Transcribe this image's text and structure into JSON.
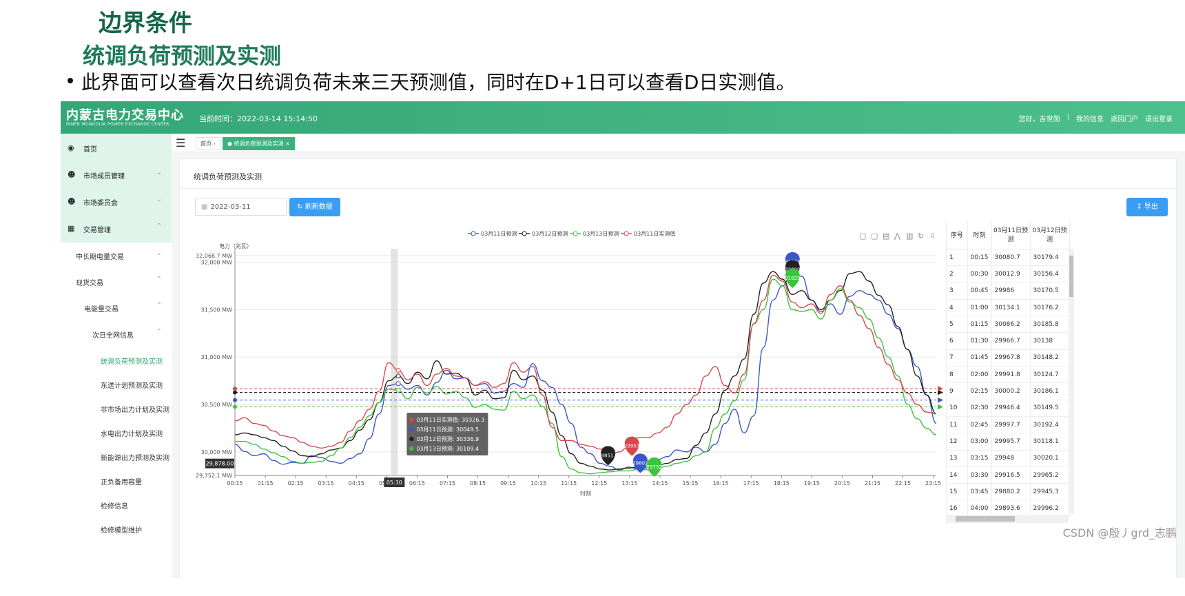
{
  "slide": {
    "title": "边界条件",
    "subtitle": "统调负荷预测及实测",
    "bullet": "此界面可以查看次日统调负荷未来三天预测值，同时在D+1日可以查看D日实测值。"
  },
  "app": {
    "logo_main": "内蒙古电力交易中心",
    "logo_sub": "INNER MONGOLIA POWER EXCHANGE CENTER",
    "current_time": "当前时间：2022-03-14 15:14:50",
    "greeting": "您好，吉世勋",
    "links": [
      "我的信息",
      "返回门户",
      "退出登录"
    ]
  },
  "sidebar": {
    "items": [
      {
        "label": "首页",
        "icon": "dashboard-icon"
      },
      {
        "label": "市场成员管理",
        "icon": "user-icon"
      },
      {
        "label": "市场委员会",
        "icon": "users-icon"
      },
      {
        "label": "交易管理",
        "icon": "grid-icon"
      }
    ],
    "sub_items": [
      "中长期电量交易",
      "现货交易",
      "电能量交易",
      "次日全网信息",
      "统调负荷预测及实测",
      "东送计划预测及实测",
      "非市场出力计划及实测",
      "水电出力计划及实测",
      "新能源出力预测及实测",
      "正负备用容量",
      "检修信息",
      "检修模型维护"
    ]
  },
  "tabs": {
    "home": "首页",
    "active": "● 统调负荷预测及实测"
  },
  "panel": {
    "title": "统调负荷预测及实测",
    "date_value": "2022-03-11",
    "refresh_label": "刷新数据",
    "export_label": "导出"
  },
  "chart_data": {
    "type": "line",
    "ylabel": "电力（兆瓦）",
    "xlabel": "时刻",
    "y_ticks": [
      "32,068.7 MW",
      "32,000 MW",
      "31,500 MW",
      "31,000 MW",
      "30,500 MW",
      "30,000 MW",
      "29,752.1 MW"
    ],
    "ylim": [
      29752.1,
      32068.7
    ],
    "x_ticks": [
      "00:15",
      "01:15",
      "02:15",
      "03:15",
      "04:15",
      "05:15",
      "06:15",
      "07:15",
      "08:15",
      "09:15",
      "10:15",
      "11:15",
      "12:15",
      "13:15",
      "14:15",
      "15:15",
      "16:15",
      "17:15",
      "18:15",
      "19:15",
      "20:15",
      "21:15",
      "22:15",
      "23:15"
    ],
    "axis_pointer_x": "05:30",
    "axis_pointer_y": "29,878.00",
    "series": [
      {
        "name": "03月11日预测",
        "color": "#3a57c9",
        "values": [
          30081,
          30005,
          29960,
          29980,
          29910,
          29870,
          29890,
          29880,
          29960,
          29940,
          29900,
          29880,
          29930,
          29980,
          30140,
          30400,
          30700,
          30720,
          30660,
          30700,
          30600,
          30730,
          30860,
          30770,
          30780,
          30700,
          30720,
          30620,
          30640,
          30720,
          30680,
          30930,
          30750,
          30680,
          30500,
          30300,
          30050,
          29980,
          29880,
          29850,
          29810,
          29840,
          29820,
          29900,
          29920,
          29950,
          30020,
          30000,
          30050,
          30000,
          30080,
          30300,
          30450,
          30200,
          30380,
          31100,
          31600,
          31750,
          31900,
          31850,
          31600,
          31480,
          31560,
          31450,
          31640,
          31700,
          31660,
          31600,
          31450,
          31300,
          31080,
          30900,
          30600,
          30300
        ]
      },
      {
        "name": "03月12日预测",
        "color": "#222222",
        "values": [
          30179,
          30200,
          30180,
          30150,
          30120,
          30060,
          30010,
          29960,
          29950,
          29980,
          30020,
          30040,
          30120,
          30230,
          30340,
          30520,
          30750,
          30800,
          30720,
          30840,
          30770,
          30960,
          30820,
          30830,
          30780,
          30600,
          30650,
          30560,
          30570,
          30860,
          30760,
          30800,
          30650,
          30420,
          30170,
          29980,
          29880,
          29850,
          29820,
          29810,
          29820,
          29830,
          29840,
          29830,
          29860,
          29880,
          29920,
          29930,
          30070,
          30200,
          30400,
          30650,
          30800,
          30980,
          31450,
          31780,
          31900,
          31820,
          31660,
          31700,
          31600,
          31500,
          31600,
          31700,
          31880,
          31900,
          31800,
          31650,
          31550,
          31320,
          31080,
          30800,
          30600,
          30400
        ]
      },
      {
        "name": "03月13日预测",
        "color": "#3cc43c",
        "values": [
          30109,
          30110,
          30080,
          30030,
          29990,
          29950,
          29900,
          29880,
          29890,
          29900,
          29960,
          30040,
          30150,
          30260,
          30380,
          30520,
          30660,
          30650,
          30560,
          30680,
          30620,
          30690,
          30610,
          30640,
          30570,
          30470,
          30500,
          30450,
          30440,
          30640,
          30560,
          30600,
          30480,
          30300,
          29950,
          29820,
          29780,
          29770,
          29780,
          29790,
          29800,
          29800,
          29820,
          29810,
          29830,
          29850,
          29880,
          29900,
          29960,
          30000,
          30250,
          30400,
          30540,
          30760,
          31350,
          31500,
          31820,
          31750,
          31500,
          31480,
          31500,
          31400,
          31600,
          31720,
          31580,
          31520,
          31400,
          31200,
          31000,
          30800,
          30500,
          30350,
          30250,
          30180
        ]
      },
      {
        "name": "03月11日实测值",
        "color": "#d9474a",
        "values": [
          30326,
          30360,
          30300,
          30280,
          30220,
          30170,
          30150,
          30100,
          30060,
          30040,
          30060,
          30100,
          30220,
          30330,
          30450,
          30640,
          30940,
          30860,
          30760,
          30820,
          30700,
          30820,
          30880,
          30800,
          30780,
          30700,
          30740,
          30680,
          30720,
          30940,
          30840,
          30900,
          30600,
          30260,
          30120,
          30120,
          30080,
          30060,
          30030,
          29960,
          30000,
          30060,
          30150,
          30150,
          30200,
          30260,
          30400,
          30500,
          30600,
          30800,
          30900,
          30700,
          30620,
          30820,
          31350,
          31600,
          31860,
          31800,
          31580,
          31520,
          31560,
          31460,
          31660,
          31750,
          31600,
          31440,
          31300,
          31100,
          30920,
          30760,
          30620,
          30500,
          30420,
          30400
        ]
      }
    ],
    "tooltip": {
      "lines": [
        "03月11日实测值: 30326.3",
        "03月11日预测: 30049.5",
        "03月12日预测: 30336.9",
        "03月13日预测: 30109.4"
      ]
    },
    "markers": [
      {
        "label": "32003",
        "series": 0
      },
      {
        "label": "32000",
        "series": 1
      },
      {
        "label": "31829",
        "series": 2
      },
      {
        "label": "29851.3",
        "series": 1
      },
      {
        "label": "29957",
        "series": 3
      },
      {
        "label": "29802",
        "series": 0
      },
      {
        "label": "29752",
        "series": 2
      }
    ]
  },
  "table": {
    "headers": [
      "序号",
      "时刻",
      "03月11日预测",
      "03月12日预测"
    ],
    "rows": [
      [
        "1",
        "00:15",
        "30080.7",
        "30179.4"
      ],
      [
        "2",
        "00:30",
        "30012.9",
        "30156.4"
      ],
      [
        "3",
        "00:45",
        "29986",
        "30170.5"
      ],
      [
        "4",
        "01:00",
        "30134.1",
        "30176.2"
      ],
      [
        "5",
        "01:15",
        "30086.2",
        "30185.8"
      ],
      [
        "6",
        "01:30",
        "29966.7",
        "30138"
      ],
      [
        "7",
        "01:45",
        "29967.8",
        "30148.2"
      ],
      [
        "8",
        "02:00",
        "29991.8",
        "30124.7"
      ],
      [
        "9",
        "02:15",
        "30000.2",
        "30186.1"
      ],
      [
        "10",
        "02:30",
        "29946.4",
        "30149.5"
      ],
      [
        "11",
        "02:45",
        "29997.7",
        "30192.4"
      ],
      [
        "12",
        "03:00",
        "29995.7",
        "30118.1"
      ],
      [
        "13",
        "03:15",
        "29948",
        "30020.1"
      ],
      [
        "14",
        "03:30",
        "29916.5",
        "29965.2"
      ],
      [
        "15",
        "03:45",
        "29880.2",
        "29945.3"
      ],
      [
        "16",
        "04:00",
        "29893.6",
        "29996.2"
      ]
    ]
  },
  "watermark": "CSDN @殷丿grd_志鹏"
}
